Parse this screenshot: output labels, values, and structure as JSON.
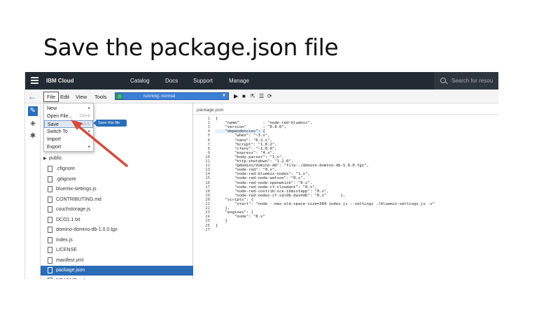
{
  "slide": {
    "title": "Save the package.json file"
  },
  "topbar": {
    "brand": "IBM Cloud",
    "nav": [
      "Catalog",
      "Docs",
      "Support",
      "Manage"
    ],
    "search_placeholder": "Search for resou"
  },
  "toolbar": {
    "menus": [
      "File",
      "Edit",
      "View",
      "Tools"
    ],
    "run_status": "running: normal"
  },
  "file_menu": {
    "items": [
      {
        "label": "New",
        "shortcut": ""
      },
      {
        "label": "Open File...",
        "shortcut": "Ctrl+E"
      },
      {
        "label": "Save",
        "shortcut": "Ctrl+S"
      },
      {
        "label": "Switch To",
        "shortcut": ""
      },
      {
        "label": "Import",
        "shortcut": ""
      },
      {
        "label": "Export",
        "shortcut": ""
      }
    ],
    "tooltip": "Save this file"
  },
  "tree": {
    "folder": "public",
    "files": [
      ".cfignore",
      ".gitignore",
      "bluemix-settings.js",
      "CONTRIBUTING.md",
      "couchstorage.js",
      "DCO1.1.txt",
      "domino-domino-db-1.0.0.tgz",
      "index.js",
      "LICENSE",
      "manifest.yml",
      "package.json",
      "README.md"
    ],
    "selected": "package.json"
  },
  "editor": {
    "tab": "package.json",
    "lines": [
      "{",
      "    \"name\"          : \"node-red-bluemix\",",
      "    \"version\"       : \"0.6.0\",",
      "    \"dependencies\": {",
      "        \"when\": \"~3.x\",",
      "        \"nano\": \"6.2.x\",",
      "        \"bcrypt\": \"1.0.2\",",
      "        \"cfenv\": \"~1.0.0\",",
      "        \"express\": \"4.x\",",
      "        \"body-parser\": \"1.x\",",
      "        \"http-shutdown\": \"1.2.0\",",
      "        \"@domino/domino-db\": \"file:./domino-domino-db-1.0.0.tgz\",",
      "        \"node-red\": \"0.x\",",
      "        \"node-red-bluemix-nodes\": \"1.x\",",
      "        \"node-red-node-watson\": \"0.x\",",
      "        \"node-red-node-openwhisk\": \"0.x\",",
      "        \"node-red-node-cf-cloudant\": \"0.x\",",
      "        \"node-red-contrib-sck-ibmiotapp\": \"0.x\",",
      "        \"node-red-nodes-cf-sqldb-dashdb\": \"0.x\"      },",
      "    \"scripts\": {",
      "        \"start\": \"node --max-old-space-size=384 index.js --settings ./bluemix-settings.js -v\"",
      "    },",
      "    \"engines\": {",
      "        \"node\": \"8.x\"",
      "    }",
      "}",
      ""
    ]
  }
}
